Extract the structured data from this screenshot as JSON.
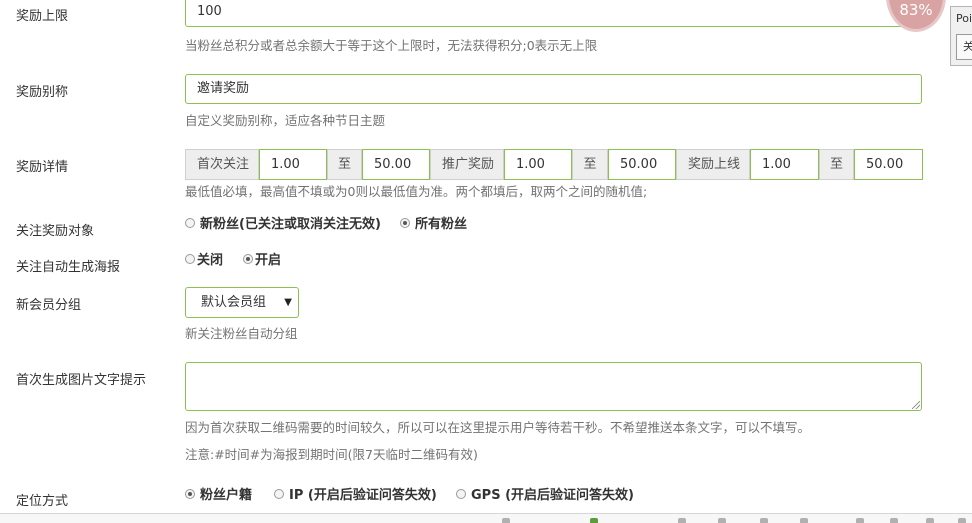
{
  "reward_limit": {
    "label": "奖励上限",
    "value": "100",
    "hint": "当粉丝总积分或者总余额大于等于这个上限时，无法获得积分;0表示无上限"
  },
  "reward_alias": {
    "label": "奖励别称",
    "value": "邀请奖励",
    "hint": "自定义奖励别称，适应各种节日主题"
  },
  "reward_detail": {
    "label": "奖励详情",
    "first_follow_label": "首次关注",
    "first_follow_min": "1.00",
    "to_1": "至",
    "first_follow_max": "50.00",
    "promote_label": "推广奖励",
    "promote_min": "1.00",
    "to_2": "至",
    "promote_max": "50.00",
    "online_label": "奖励上线",
    "online_min": "1.00",
    "to_3": "至",
    "online_max": "50.00",
    "hint": "最低值必填，最高值不填或为0则以最低值为准。两个都填后，取两个之间的随机值;"
  },
  "follow_target": {
    "label": "关注奖励对象",
    "options": [
      "新粉丝(已关注或取消关注无效)",
      "所有粉丝"
    ],
    "selected": 1
  },
  "auto_poster": {
    "label": "关注自动生成海报",
    "options": [
      "关闭",
      "开启"
    ],
    "selected": 1
  },
  "member_group": {
    "label": "新会员分组",
    "selected": "默认会员组",
    "hint": "新关注粉丝自动分组"
  },
  "first_image_text": {
    "label": "首次生成图片文字提示",
    "value": "",
    "hint": "因为首次获取二维码需要的时间较久，所以可以在这里提示用户等待若干秒。不希望推送本条文字，可以不填写。",
    "note": "注意:#时间#为海报到期时间(限7天临时二维码有效)"
  },
  "location_mode": {
    "label": "定位方式",
    "options": [
      "粉丝户籍",
      "IP (开启后验证问答失效)",
      "GPS (开启后验证问答失效)"
    ],
    "selected": 0
  },
  "overlay": {
    "circle_text": "83%",
    "popup_title": "Poi",
    "popup_button": "关"
  }
}
